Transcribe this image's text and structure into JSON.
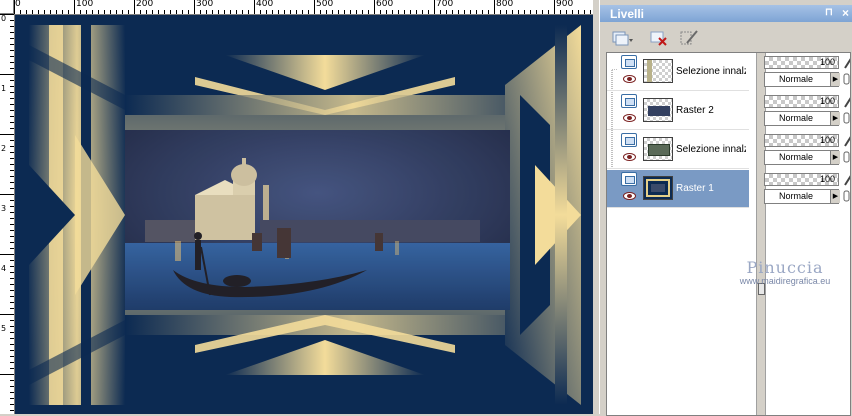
{
  "ruler_top": {
    "labels": [
      "0",
      "100",
      "200",
      "300",
      "400",
      "500",
      "600",
      "700",
      "800",
      "900"
    ]
  },
  "ruler_left": {
    "labels": [
      "0",
      "1",
      "2",
      "3",
      "4",
      "5"
    ]
  },
  "panel": {
    "title": "Livelli",
    "pin_glyph": "⊓",
    "close_glyph": "×"
  },
  "layers": [
    {
      "name": "Selezione innalzat",
      "opacity": "100",
      "blend": "Normale",
      "selected": false,
      "thumb": "pattern"
    },
    {
      "name": "Raster 2",
      "opacity": "100",
      "blend": "Normale",
      "selected": false,
      "thumb": "checker"
    },
    {
      "name": "Selezione innalzat",
      "opacity": "100",
      "blend": "Normale",
      "selected": false,
      "thumb": "pattern"
    },
    {
      "name": "Raster 1",
      "opacity": "100",
      "blend": "Normale",
      "selected": true,
      "thumb": "full"
    }
  ],
  "watermark": {
    "name": "Pinuccia",
    "url": "www.maidiregrafica.eu"
  },
  "colors": {
    "navy": "#0c2a52",
    "gold": "#f3dc9a",
    "panel_bg": "#d4d0c8",
    "selection": "#7a9ac4",
    "title_bar": "#8fb0dc"
  }
}
